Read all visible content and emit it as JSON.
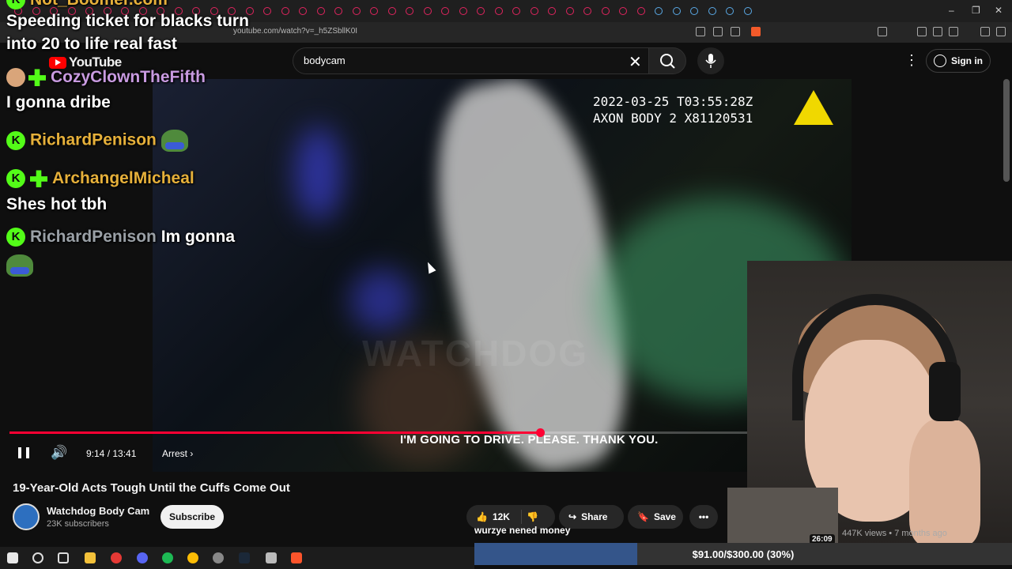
{
  "browser": {
    "url": "youtube.com/watch?v=_h5ZSbllK0I"
  },
  "header": {
    "logo_text": "YouTube",
    "search_value": "bodycam",
    "signin_label": "Sign in"
  },
  "video": {
    "timestamp_line1": "2022-03-25 T03:55:28Z",
    "timestamp_line2": "AXON BODY 2 X81120531",
    "caption": "I'M GOING TO DRIVE. PLEASE. THANK YOU.",
    "watermark": "WATCHDOG",
    "progress": 0.6733,
    "time": "9:14 / 13:41",
    "chapter": "Arrest",
    "title": "19-Year-Old Acts Tough Until the Cuffs Come Out"
  },
  "channel": {
    "name": "Watchdog Body Cam",
    "subscribers": "23K subscribers",
    "subscribe_label": "Subscribe"
  },
  "actions": {
    "likes": "12K",
    "share_label": "Share",
    "save_label": "Save"
  },
  "chat": {
    "top_user": "Not_Boomer.com",
    "top_message_1": "Speeding ticket for blacks turn",
    "top_message_2": "into 20 to life real fast",
    "lines": [
      {
        "user": "CozyClownTheFifth",
        "color": "#c89ae0"
      },
      {
        "message": "I gonna dribe"
      },
      {
        "user": "RichardPenison",
        "color": "#e6b03a"
      },
      {
        "user": "ArchangelMicheal",
        "color": "#e6b03a"
      },
      {
        "message": "Shes hot tbh"
      },
      {
        "user": "RichardPenison",
        "color": "#9aa0a6",
        "message": "Im gonna"
      }
    ]
  },
  "recommendation": {
    "duration": "26:09",
    "meta": "447K views • 7 months ago"
  },
  "donation": {
    "donor_message": "wurzye nened money",
    "goal_text": "$91.00/$300.00 (30%)",
    "progress": 0.3033,
    "fill_color": "#34558a"
  }
}
